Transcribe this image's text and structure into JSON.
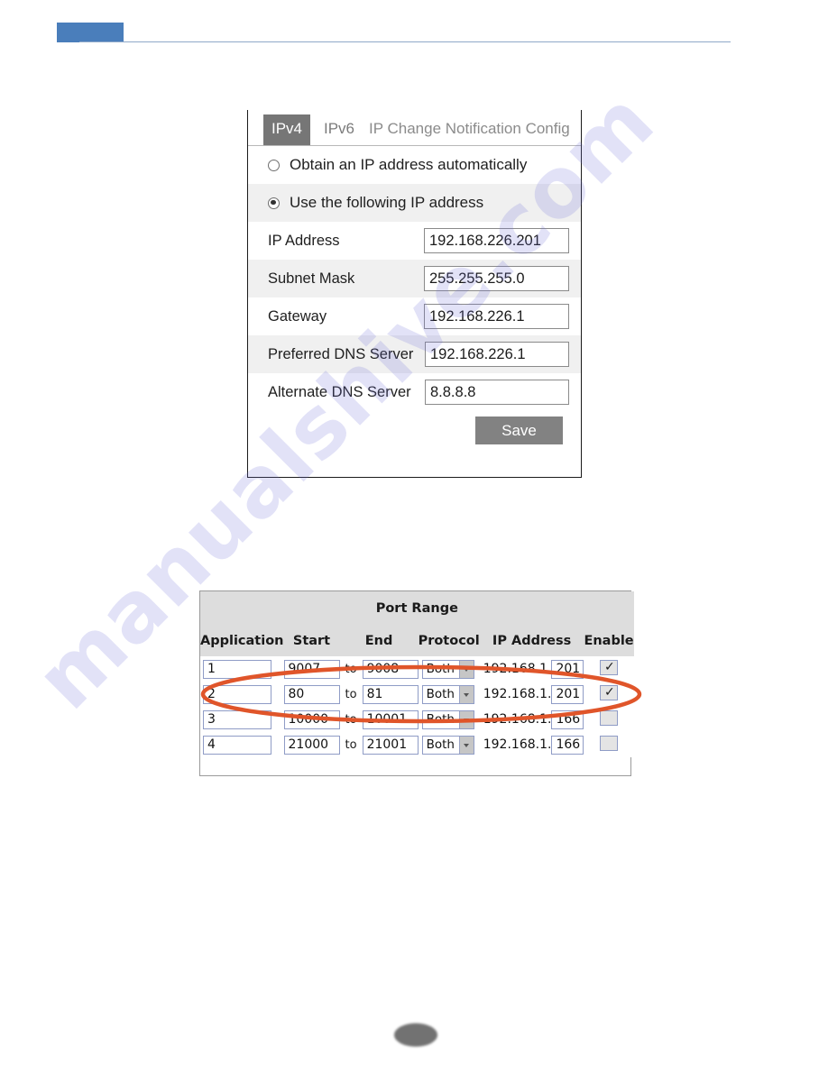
{
  "page": {
    "header_accent_color": "#4a7ebb",
    "header_rule_color": "#8fa9c9",
    "watermark_text": "manualshive.com",
    "watermark_color": "#6e6ed7",
    "footer_badge": ""
  },
  "ip_dialog": {
    "tabs": [
      {
        "label": "IPv4",
        "active": true
      },
      {
        "label": "IPv6",
        "active": false
      },
      {
        "label": "IP Change Notification Config",
        "active": false
      }
    ],
    "radio_options": [
      {
        "label": "Obtain an IP address automatically",
        "selected": false
      },
      {
        "label": "Use the following IP address",
        "selected": true
      }
    ],
    "fields": [
      {
        "label": "IP Address",
        "value": "192.168.226.201"
      },
      {
        "label": "Subnet Mask",
        "value": "255.255.255.0"
      },
      {
        "label": "Gateway",
        "value": "192.168.226.1"
      },
      {
        "label": "Preferred DNS Server",
        "value": "192.168.226.1"
      },
      {
        "label": "Alternate DNS Server",
        "value": "8.8.8.8"
      }
    ],
    "save_label": "Save",
    "save_color": "#828282",
    "active_tab_color": "#767676"
  },
  "port_range": {
    "title": "Port Range",
    "columns": [
      "Application",
      "Start",
      "End",
      "Protocol",
      "IP Address",
      "Enable"
    ],
    "to_label": "to",
    "header_bg": "#dddddd",
    "rows": [
      {
        "application": "1",
        "start": "9007",
        "end": "9008",
        "protocol": "Both",
        "ip_prefix": "192.168.1.",
        "ip_octet": "201",
        "enabled": true
      },
      {
        "application": "2",
        "start": "80",
        "end": "81",
        "protocol": "Both",
        "ip_prefix": "192.168.1.",
        "ip_octet": "201",
        "enabled": true
      },
      {
        "application": "3",
        "start": "10000",
        "end": "10001",
        "protocol": "Both",
        "ip_prefix": "192.168.1.",
        "ip_octet": "166",
        "enabled": false
      },
      {
        "application": "4",
        "start": "21000",
        "end": "21001",
        "protocol": "Both",
        "ip_prefix": "192.168.1.",
        "ip_octet": "166",
        "enabled": false
      }
    ]
  },
  "annotation": {
    "shape": "ellipse",
    "color": "#e0552a",
    "covers_rows": [
      1,
      2
    ]
  }
}
